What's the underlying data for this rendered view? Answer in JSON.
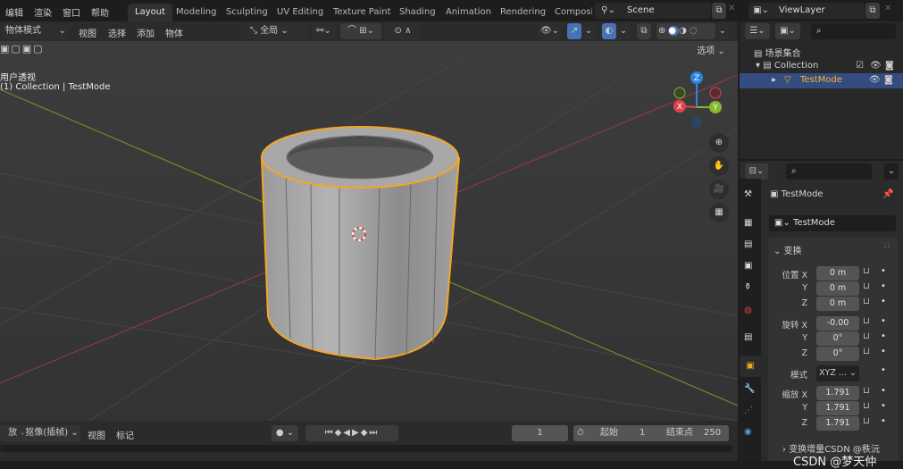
{
  "topbar": {
    "menus": [
      "编辑",
      "渲染",
      "窗口",
      "帮助"
    ],
    "workspaces": [
      "Layout",
      "Modeling",
      "Sculpting",
      "UV Editing",
      "Texture Paint",
      "Shading",
      "Animation",
      "Rendering",
      "Composi"
    ],
    "active_workspace": "Layout",
    "scene": "Scene",
    "view_layer": "ViewLayer"
  },
  "viewport_header": {
    "mode": "物体模式",
    "menus": [
      "视图",
      "选择",
      "添加",
      "物体"
    ],
    "transform_orientation": "全局",
    "options": "选项"
  },
  "viewport": {
    "view_name": "用户透视",
    "object_info": "(1) Collection | TestMode",
    "gizmo": {
      "x": "X",
      "y": "Y",
      "z": "Z"
    },
    "colors": {
      "x": "#e0414f",
      "y": "#84b82f",
      "z": "#2d85e0",
      "selection": "#f5a623"
    }
  },
  "outliner": {
    "scene_collection": "场景集合",
    "collection": "Collection",
    "object": "TestMode"
  },
  "properties": {
    "object_name": "TestMode",
    "datablock": "TestMode",
    "panel": "变换",
    "location": {
      "label": "位置",
      "x": "0 m",
      "y": "0 m",
      "z": "0 m"
    },
    "rotation": {
      "label": "旋转",
      "x": "-0.00",
      "y": "0°",
      "z": "0°"
    },
    "mode": {
      "label": "模式",
      "value": "XYZ ..."
    },
    "scale": {
      "label": "缩放",
      "x": "1.791",
      "y": "1.791",
      "z": "1.791"
    },
    "axes": [
      "X",
      "Y",
      "Z"
    ],
    "delta_panel": "变换增量",
    "watermark": "CSDN @秩沅"
  },
  "timeline": {
    "playback": "放",
    "keying": "抠像(插帧)",
    "menus": [
      "视图",
      "标记"
    ],
    "current_frame": "1",
    "start_label": "起始",
    "start": "1",
    "end_label": "结束点",
    "end": "250"
  },
  "bottom_watermark": "CSDN @梦天仲"
}
